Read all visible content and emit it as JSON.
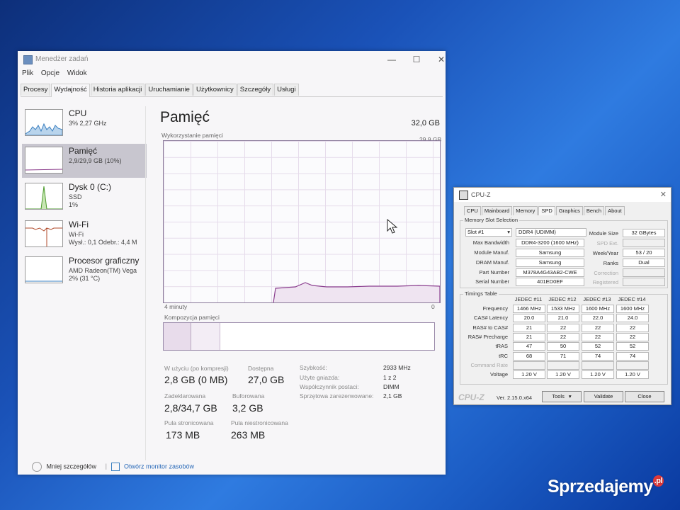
{
  "taskmgr": {
    "title": "Menedżer zadań",
    "menu": [
      "Plik",
      "Opcje",
      "Widok"
    ],
    "tabs": [
      "Procesy",
      "Wydajność",
      "Historia aplikacji",
      "Uruchamianie",
      "Użytkownicy",
      "Szczegóły",
      "Usługi"
    ],
    "active_tab": "Wydajność",
    "sidebar": [
      {
        "name": "CPU",
        "sub1": "3% 2,27 GHz",
        "sub2": "",
        "sub3": ""
      },
      {
        "name": "Pamięć",
        "sub1": "2,9/29,9 GB (10%)",
        "sub2": "",
        "sub3": ""
      },
      {
        "name": "Dysk 0 (C:)",
        "sub1": "SSD",
        "sub2": "1%",
        "sub3": ""
      },
      {
        "name": "Wi-Fi",
        "sub1": "Wi-Fi",
        "sub2": "Wysł.: 0,1 Odebr.: 4,4 M",
        "sub3": ""
      },
      {
        "name": "Procesor graficzny",
        "sub1": "AMD Radeon(TM) Vega",
        "sub2": "2% (31 °C)",
        "sub3": ""
      }
    ],
    "main": {
      "title": "Pamięć",
      "total": "32,0 GB",
      "usage_label": "Wykorzystanie pamięci",
      "usage_max": "29,9 GB",
      "time_label": "4 minuty",
      "zero_label": "0",
      "composition_label": "Kompozycja pamięci",
      "stats": {
        "in_use_label": "W użyciu (po kompresji)",
        "in_use": "2,8 GB (0 MB)",
        "available_label": "Dostępna",
        "available": "27,0 GB",
        "committed_label": "Zadeklarowana",
        "committed": "2,8/34,7 GB",
        "cached_label": "Buforowana",
        "cached": "3,2 GB",
        "paged_label": "Pula stronicowana",
        "paged": "173 MB",
        "nonpaged_label": "Pula niestronicowana",
        "nonpaged": "263 MB"
      },
      "details": [
        {
          "k": "Szybkość:",
          "v": "2933 MHz"
        },
        {
          "k": "Użyte gniazda:",
          "v": "1 z 2"
        },
        {
          "k": "Współczynnik postaci:",
          "v": "DIMM"
        },
        {
          "k": "Sprzętowa zarezerwowane:",
          "v": "2,1 GB"
        }
      ]
    },
    "footer": {
      "less": "Mniej szczegółów",
      "monitor": "Otwórz monitor zasobów"
    }
  },
  "cpuz": {
    "title": "CPU-Z",
    "tabs": [
      "CPU",
      "Mainboard",
      "Memory",
      "SPD",
      "Graphics",
      "Bench",
      "About"
    ],
    "active_tab": "SPD",
    "slot_group": "Memory Slot Selection",
    "slot": "Slot #1",
    "type": "DDR4 (UDIMM)",
    "fields": [
      {
        "label": "Max Bandwidth",
        "value": "DDR4-3200 (1600 MHz)"
      },
      {
        "label": "Module Manuf.",
        "value": "Samsung"
      },
      {
        "label": "DRAM Manuf.",
        "value": "Samsung"
      },
      {
        "label": "Part Number",
        "value": "M378A4G43AB2-CWE"
      },
      {
        "label": "Serial Number",
        "value": "401ED0EF"
      }
    ],
    "right_fields": [
      {
        "label": "Module Size",
        "value": "32 GBytes"
      },
      {
        "label": "SPD Ext.",
        "value": ""
      },
      {
        "label": "Week/Year",
        "value": "53 / 20"
      },
      {
        "label": "Ranks",
        "value": "Dual"
      },
      {
        "label": "Correction",
        "value": ""
      },
      {
        "label": "Registered",
        "value": ""
      }
    ],
    "timings_group": "Timings Table",
    "timing_cols": [
      "JEDEC #11",
      "JEDEC #12",
      "JEDEC #13",
      "JEDEC #14"
    ],
    "timing_rows": [
      {
        "label": "Frequency",
        "values": [
          "1466 MHz",
          "1533 MHz",
          "1600 MHz",
          "1600 MHz"
        ]
      },
      {
        "label": "CAS# Latency",
        "values": [
          "20.0",
          "21.0",
          "22.0",
          "24.0"
        ]
      },
      {
        "label": "RAS# to CAS#",
        "values": [
          "21",
          "22",
          "22",
          "22"
        ]
      },
      {
        "label": "RAS# Precharge",
        "values": [
          "21",
          "22",
          "22",
          "22"
        ]
      },
      {
        "label": "tRAS",
        "values": [
          "47",
          "50",
          "52",
          "52"
        ]
      },
      {
        "label": "tRC",
        "values": [
          "68",
          "71",
          "74",
          "74"
        ]
      },
      {
        "label": "Command Rate",
        "values": [
          "",
          "",
          "",
          ""
        ]
      },
      {
        "label": "Voltage",
        "values": [
          "1.20 V",
          "1.20 V",
          "1.20 V",
          "1.20 V"
        ]
      }
    ],
    "footer": {
      "brand": "CPU-Z",
      "version": "Ver. 2.15.0.x64",
      "tools": "Tools",
      "validate": "Validate",
      "close": "Close"
    }
  },
  "watermark": {
    "text": "Sprzedajemy",
    "suffix": ".pl"
  }
}
